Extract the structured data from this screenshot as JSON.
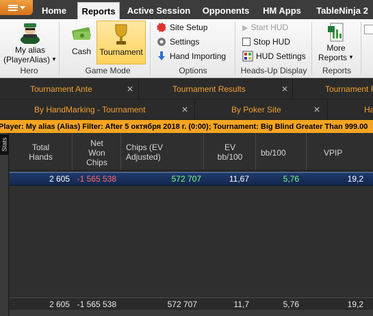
{
  "menu_tabs": [
    "Home",
    "Reports",
    "Active Session",
    "Opponents",
    "HM Apps",
    "TableNinja 2"
  ],
  "hero": {
    "label": "My alias\n(PlayerAlias)",
    "line1": "My alias",
    "line2": "(PlayerAlias)",
    "group": "Hero"
  },
  "game_mode": {
    "cash": "Cash",
    "tournament": "Tournament",
    "group": "Game Mode"
  },
  "options": {
    "site_setup": "Site Setup",
    "settings": "Settings",
    "hand_importing": "Hand Importing",
    "group": "Options"
  },
  "hud": {
    "start": "Start HUD",
    "stop": "Stop HUD",
    "settings": "HUD Settings",
    "group": "Heads-Up Display"
  },
  "reports": {
    "more": "More",
    "reports": "Reports",
    "group": "Reports"
  },
  "report_tabs": [
    "Tournament Ante",
    "Tournament Results",
    "Tournament R"
  ],
  "sub_tabs": [
    "By HandMarking - Tournament",
    "By Poker Site",
    "Ha"
  ],
  "filter_text": "Player: My alias (Alias)  Filter: After 5 октября 2018 г. (0:00); Tournament: Big Blind Greater Than 999.00",
  "stats_label": "Stats",
  "columns": [
    "Total\nHands",
    "Net\nWon\nChips",
    "Chips (EV\nAdjusted)",
    "EV\nbb/100",
    "bb/100",
    "VPIP"
  ],
  "col_lines": {
    "total_hands": [
      "Total",
      "Hands"
    ],
    "net_won": [
      "Net",
      "Won",
      "Chips"
    ],
    "chips_ev": [
      "Chips (EV",
      "Adjusted)"
    ],
    "ev_bb": [
      "EV",
      "bb/100"
    ],
    "bb100": [
      "bb/100"
    ],
    "vpip": [
      "VPIP"
    ]
  },
  "row": {
    "total_hands": "2 605",
    "net_won": "-1 565 538",
    "chips_ev": "572 707",
    "ev_bb": "11,67",
    "bb100": "5,76",
    "vpip": "19,2"
  },
  "totals": {
    "total_hands": "2 605",
    "net_won": "-1 565 538",
    "chips_ev": "572 707",
    "ev_bb": "11,7",
    "bb100": "5,76",
    "vpip": "19,2"
  },
  "colors": {
    "accent": "#f5a522",
    "negative": "#ff6b6b",
    "positive": "#7cff7c",
    "row_selected": "#1f3a6c"
  }
}
